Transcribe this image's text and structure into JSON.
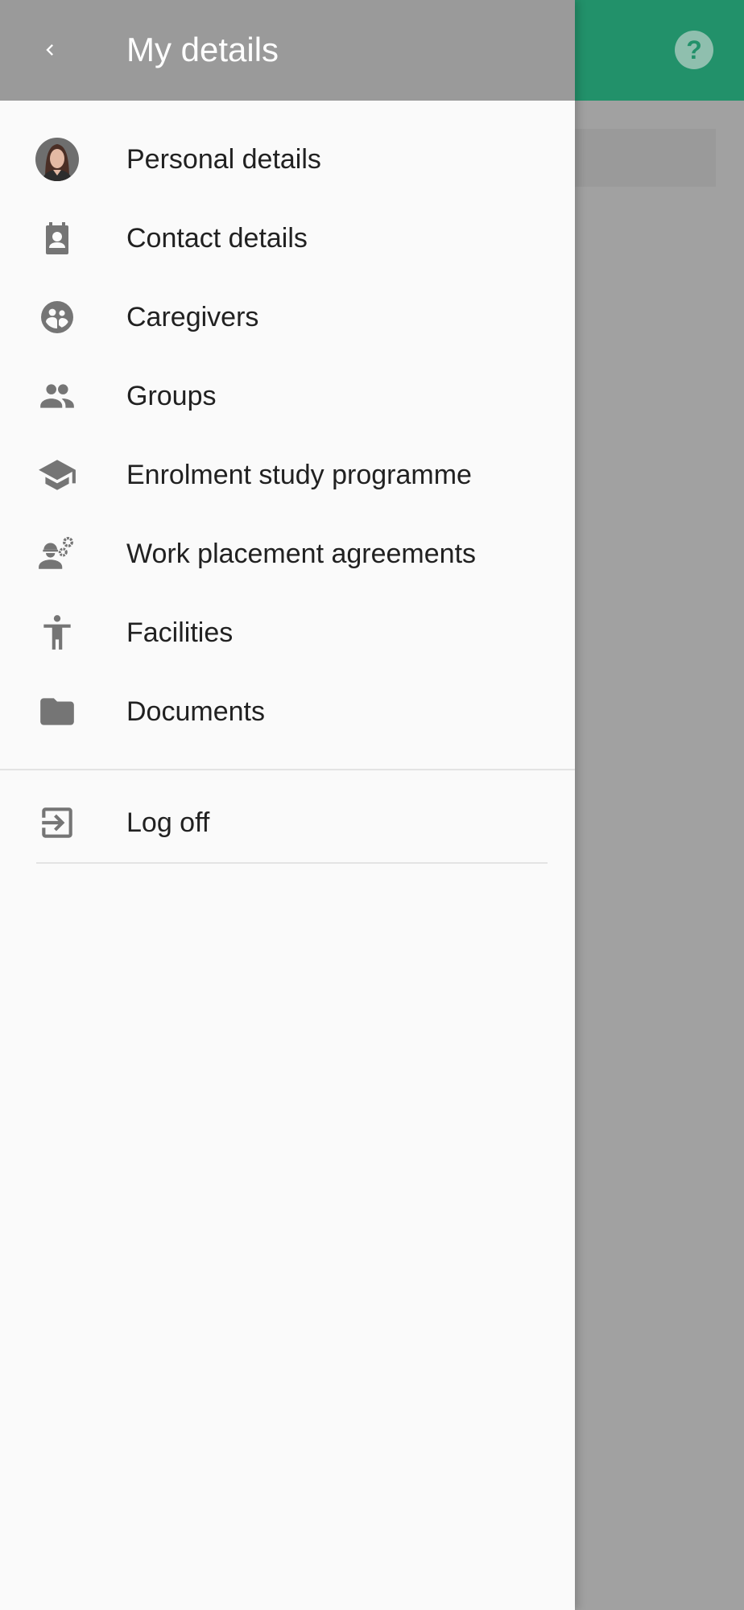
{
  "drawer": {
    "title": "My details",
    "items": [
      {
        "label": "Personal details",
        "icon": "avatar"
      },
      {
        "label": "Contact details",
        "icon": "contact-icon"
      },
      {
        "label": "Caregivers",
        "icon": "caregivers-icon"
      },
      {
        "label": "Groups",
        "icon": "groups-icon"
      },
      {
        "label": "Enrolment study programme",
        "icon": "graduation-cap-icon"
      },
      {
        "label": "Work placement agreements",
        "icon": "worker-gears-icon"
      },
      {
        "label": "Facilities",
        "icon": "accessibility-icon"
      },
      {
        "label": "Documents",
        "icon": "folder-icon"
      }
    ],
    "logoff": {
      "label": "Log off",
      "icon": "logout-icon"
    }
  },
  "app": {
    "help_symbol": "?"
  },
  "colors": {
    "appbar_accent": "#22916a",
    "drawer_header": "#9a9a9a",
    "icon_gray": "#757575"
  }
}
